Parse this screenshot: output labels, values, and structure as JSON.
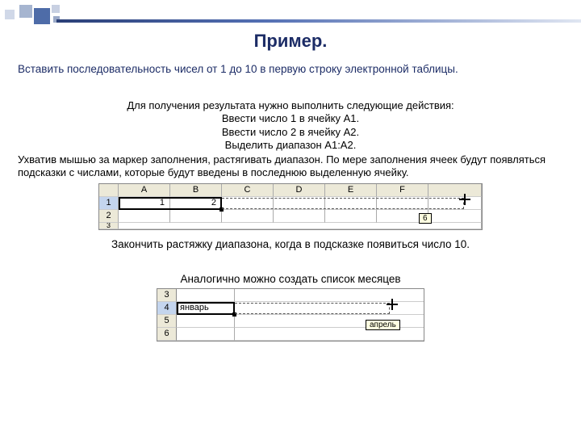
{
  "title": "Пример.",
  "intro": "Вставить последовательность чисел от 1 до 10 в первую строку электронной таблицы.",
  "steps": {
    "lead": "Для получения результата нужно выполнить следующие действия:",
    "s1": "Ввести число 1 в ячейку A1.",
    "s2": "Ввести число 2 в ячейку A2.",
    "s3": "Выделить диапазон A1:A2."
  },
  "para": "Ухватив мышью за маркер заполнения, растягивать диапазон. По мере заполнения ячеек будут появляться подсказки с числами, которые будут введены в последнюю выделенную ячейку.",
  "sheet1": {
    "cols": [
      "A",
      "B",
      "C",
      "D",
      "E",
      "F"
    ],
    "rows": [
      "1",
      "2",
      "3"
    ],
    "a1": "1",
    "b1": "2",
    "tooltip": "6"
  },
  "finish": "Закончить растяжку диапазона, когда в подсказке появиться число 10.",
  "analog": "Аналогично можно создать список месяцев",
  "sheet2": {
    "rows": [
      "3",
      "4",
      "5",
      "6"
    ],
    "a4": "январь",
    "tooltip": "апрель"
  }
}
